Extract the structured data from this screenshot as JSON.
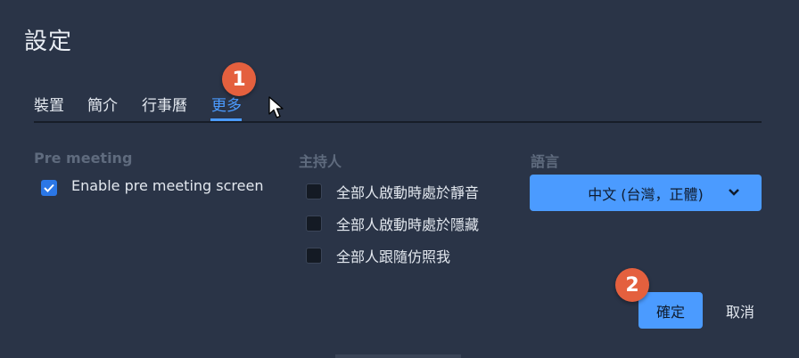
{
  "dialog": {
    "title": "設定"
  },
  "tabs": [
    {
      "label": "裝置",
      "active": false
    },
    {
      "label": "簡介",
      "active": false
    },
    {
      "label": "行事曆",
      "active": false
    },
    {
      "label": "更多",
      "active": true
    }
  ],
  "pre_meeting": {
    "label": "Pre meeting",
    "option": {
      "label": "Enable pre meeting screen",
      "checked": true
    }
  },
  "host": {
    "label": "主持人",
    "options": [
      {
        "label": "全部人啟動時處於靜音",
        "checked": false
      },
      {
        "label": "全部人啟動時處於隱藏",
        "checked": false
      },
      {
        "label": "全部人跟隨仿照我",
        "checked": false
      }
    ]
  },
  "language": {
    "label": "語言",
    "selected": "中文 (台灣，正體)"
  },
  "buttons": {
    "ok": "確定",
    "cancel": "取消"
  },
  "annotations": {
    "step1": "1",
    "step2": "2"
  },
  "colors": {
    "background": "#2a3447",
    "accent": "#4b9bff",
    "badge": "#e4603e",
    "checkbox_checked": "#2b77e6"
  }
}
